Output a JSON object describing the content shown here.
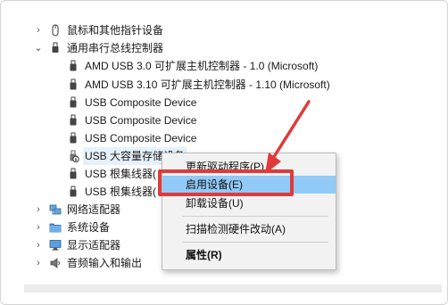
{
  "tree": {
    "items": [
      {
        "label": "鼠标和其他指针设备",
        "icon": "mouse-icon"
      },
      {
        "label": "通用串行总线控制器",
        "icon": "usb-icon"
      },
      {
        "label": "AMD USB 3.0 可扩展主机控制器 - 1.0 (Microsoft)",
        "icon": "usb-plug-icon"
      },
      {
        "label": "AMD USB 3.10 可扩展主机控制器 - 1.10 (Microsoft)",
        "icon": "usb-plug-icon"
      },
      {
        "label": "USB Composite Device",
        "icon": "usb-plug-icon"
      },
      {
        "label": "USB Composite Device",
        "icon": "usb-plug-icon"
      },
      {
        "label": "USB Composite Device",
        "icon": "usb-plug-icon"
      },
      {
        "label": "USB 大容量存储设备",
        "icon": "usb-disabled-icon"
      },
      {
        "label": "USB 根集线器(",
        "icon": "usb-plug-icon"
      },
      {
        "label": "USB 根集线器(",
        "icon": "usb-plug-icon"
      },
      {
        "label": "网络适配器",
        "icon": "network-icon"
      },
      {
        "label": "系统设备",
        "icon": "folder-icon"
      },
      {
        "label": "显示适配器",
        "icon": "monitor-icon"
      },
      {
        "label": "音频输入和输出",
        "icon": "speaker-icon"
      }
    ]
  },
  "context_menu": {
    "items": [
      {
        "label": "更新驱动程序(P)"
      },
      {
        "label": "启用设备(E)"
      },
      {
        "label": "卸载设备(U)"
      },
      {
        "label": "扫描检测硬件改动(A)"
      },
      {
        "label": "属性(R)"
      }
    ]
  },
  "colors": {
    "highlight": "#91c9f7",
    "callout": "#e03a3a"
  }
}
